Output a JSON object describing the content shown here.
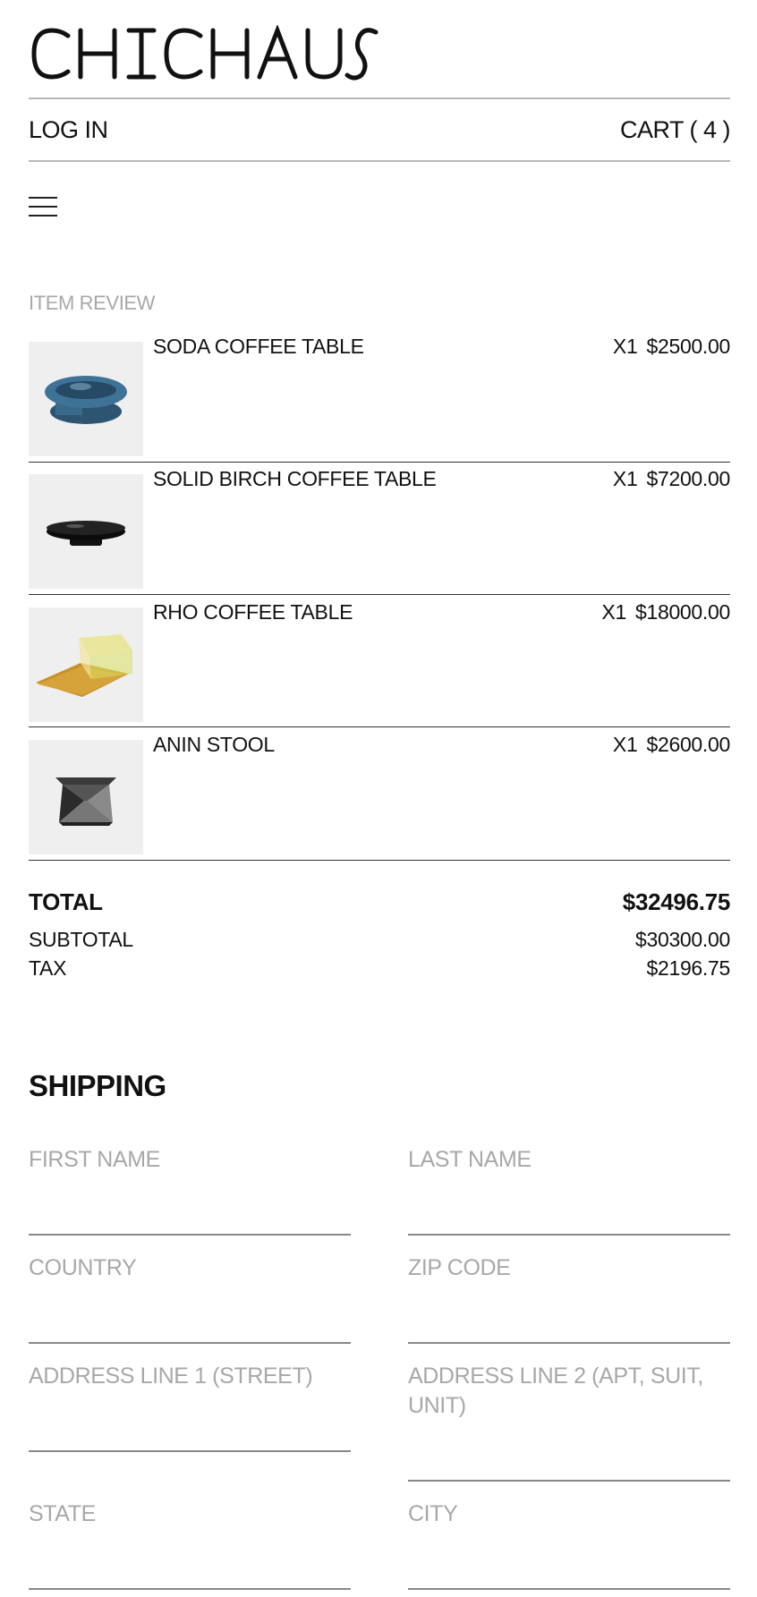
{
  "brand": {
    "name": "CHICHAUS"
  },
  "nav": {
    "login": "LOG IN",
    "cart": "CART ( 4 )"
  },
  "icons": {
    "menu": "hamburger-icon"
  },
  "review": {
    "label": "ITEM REVIEW",
    "items": [
      {
        "name": "SODA COFFEE TABLE",
        "qty": "X1",
        "price": "$2500.00",
        "image": "blue-glass-table"
      },
      {
        "name": "SOLID BIRCH COFFEE TABLE",
        "qty": "X1",
        "price": "$7200.00",
        "image": "black-table"
      },
      {
        "name": "RHO COFFEE TABLE",
        "qty": "X1",
        "price": "$18000.00",
        "image": "iridescent-table"
      },
      {
        "name": "ANIN STOOL",
        "qty": "X1",
        "price": "$2600.00",
        "image": "steel-stool"
      }
    ]
  },
  "totals": {
    "total_label": "TOTAL",
    "total_value": "$32496.75",
    "subtotal_label": "SUBTOTAL",
    "subtotal_value": "$30300.00",
    "tax_label": "TAX",
    "tax_value": "$2196.75"
  },
  "shipping": {
    "title": "SHIPPING",
    "first_name": "FIRST NAME",
    "last_name": "LAST NAME",
    "country": "COUNTRY",
    "zip": "ZIP CODE",
    "address1": "ADDRESS LINE 1 (STREET)",
    "address2": "ADDRESS LINE 2 (APT, SUIT, UNIT)",
    "state": "STATE",
    "city": "CITY"
  },
  "colors": {
    "text": "#111111",
    "muted": "#a8a8a8",
    "thumb_bg": "#efefef",
    "rule": "#b8b8b8"
  }
}
